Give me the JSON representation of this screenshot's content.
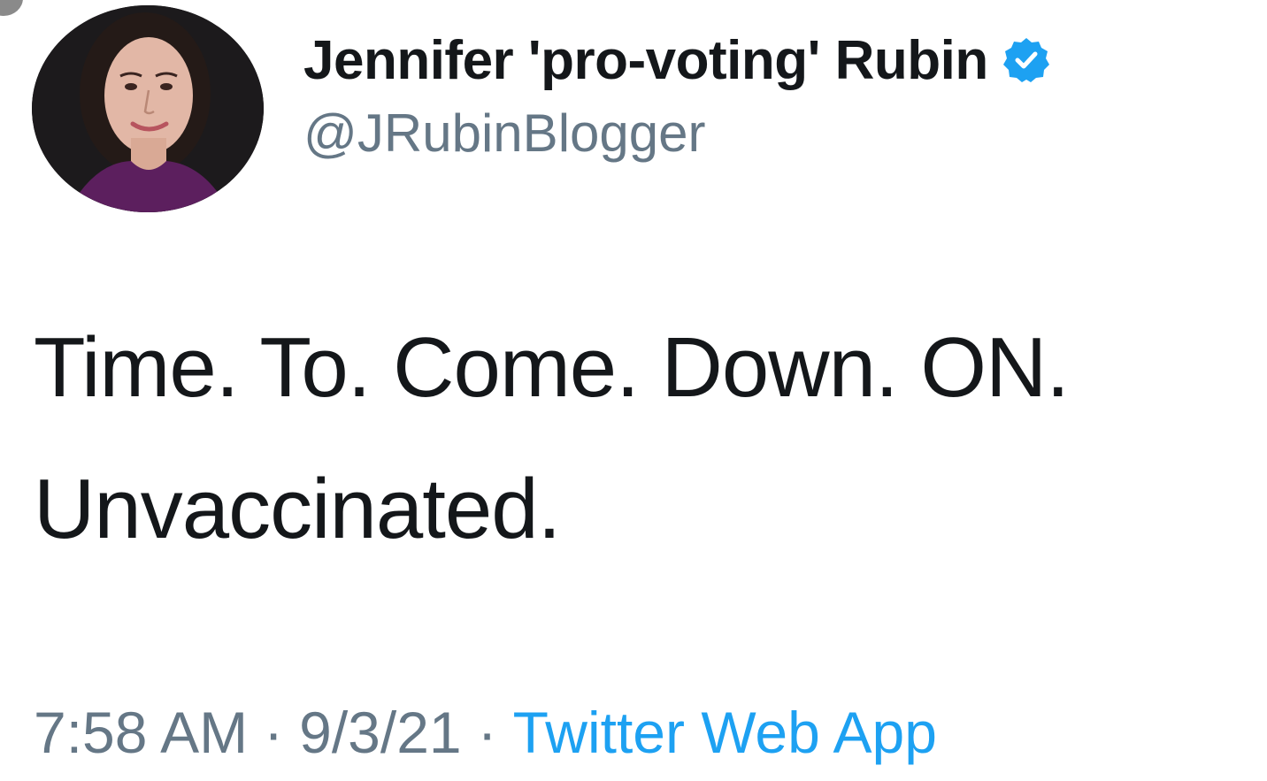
{
  "tweet": {
    "author": {
      "display_name": "Jennifer 'pro-voting' Rubin",
      "handle": "@JRubinBlogger",
      "verified": true,
      "avatar_icon": "profile-photo"
    },
    "text_lines": [
      "Time. To. Come. Down. ON.",
      "Unvaccinated."
    ],
    "meta": {
      "time": "7:58 AM",
      "separator": "·",
      "date": "9/3/21",
      "source": "Twitter Web App"
    }
  },
  "colors": {
    "text_primary": "#14171a",
    "text_secondary": "#657786",
    "link_blue": "#1da1f2",
    "verified_blue": "#1da1f2",
    "background": "#ffffff"
  }
}
